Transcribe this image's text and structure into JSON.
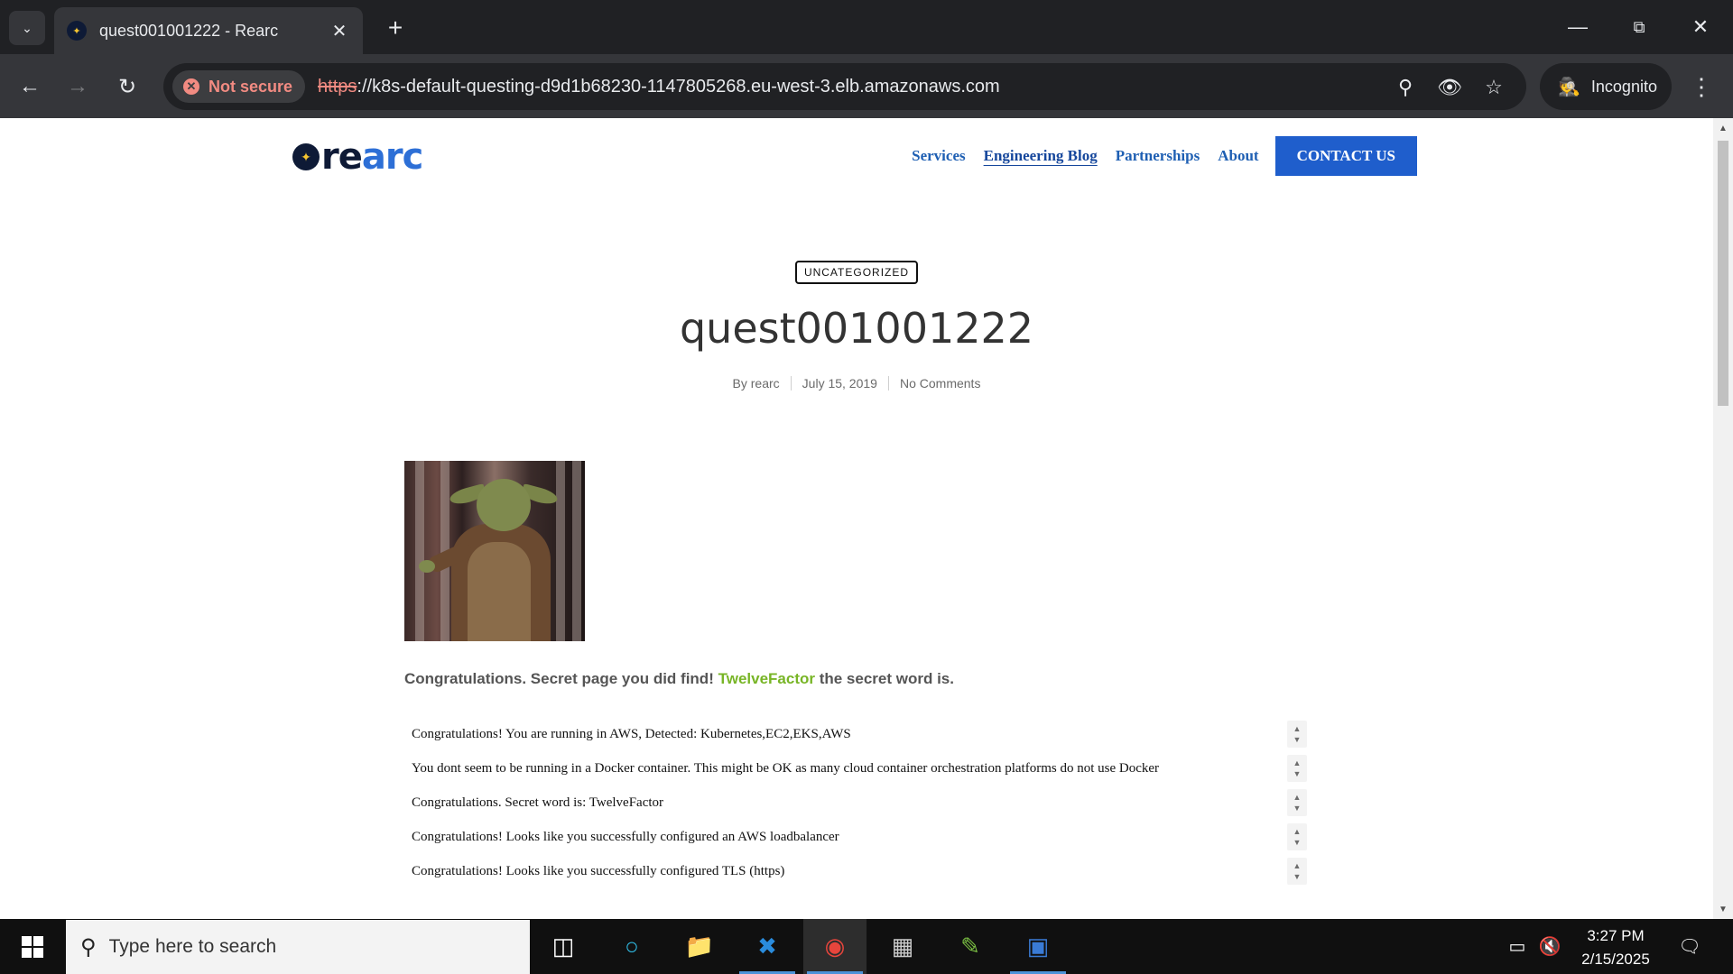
{
  "browser": {
    "tab_title": "quest001001222 - Rearc",
    "new_tab_symbol": "+",
    "security_label": "Not secure",
    "url_scheme": "https",
    "url_rest": "://k8s-default-questing-d9d1b68230-1147805268.eu-west-3.elb.amazonaws.com",
    "incognito_label": "Incognito",
    "icons": [
      "tab-search-icon",
      "back-icon",
      "forward-icon",
      "reload-icon",
      "zoom-icon",
      "eye-off-icon",
      "bookmark-star-icon",
      "incognito-icon",
      "menu-icon",
      "minimize-icon",
      "restore-icon",
      "close-window-icon"
    ]
  },
  "site": {
    "logo_text_1": "re",
    "logo_text_2": "arc",
    "nav": {
      "services": "Services",
      "blog": "Engineering Blog",
      "partnerships": "Partnerships",
      "about": "About",
      "contact": "CONTACT US"
    },
    "colors": {
      "nav_link": "#1e5fb3",
      "contact_bg": "#1f5ecc",
      "secret_word": "#78b526"
    }
  },
  "post": {
    "category": "UNCATEGORIZED",
    "title": "quest001001222",
    "byline": {
      "author": "By rearc",
      "date": "July 15, 2019",
      "comments": "No Comments"
    },
    "secret_pre": "Congratulations. Secret page you did find! ",
    "secret_word": "TwelveFactor",
    "secret_post": " the secret word is.",
    "checks": [
      "Congratulations! You are running in AWS, Detected: Kubernetes,EC2,EKS,AWS",
      "You dont seem to be running in a Docker container. This might be OK as many cloud container orchestration platforms do not use Docker",
      "Congratulations. Secret word is: TwelveFactor",
      "Congratulations! Looks like you successfully configured an AWS loadbalancer",
      "Congratulations! Looks like you successfully configured TLS (https)"
    ]
  },
  "taskbar": {
    "search_placeholder": "Type here to search",
    "time": "3:27 PM",
    "date": "2/15/2025",
    "apps": [
      "task-view-icon",
      "edge-icon",
      "file-explorer-icon",
      "vscode-icon",
      "chrome-icon",
      "terminal-icon",
      "notepad-icon",
      "network-app-icon"
    ]
  }
}
